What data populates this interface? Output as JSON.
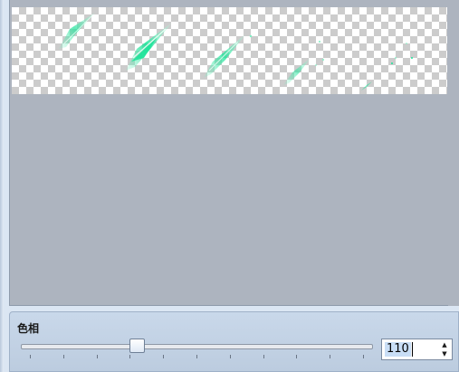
{
  "hue_panel": {
    "label": "色相",
    "slider_fraction": 0.33,
    "value": "110"
  },
  "preview": {
    "background_color": "#adb4bf",
    "effect_color": "#1fe39a"
  },
  "icons": {
    "spin_up": "▲",
    "spin_down": "▼"
  }
}
